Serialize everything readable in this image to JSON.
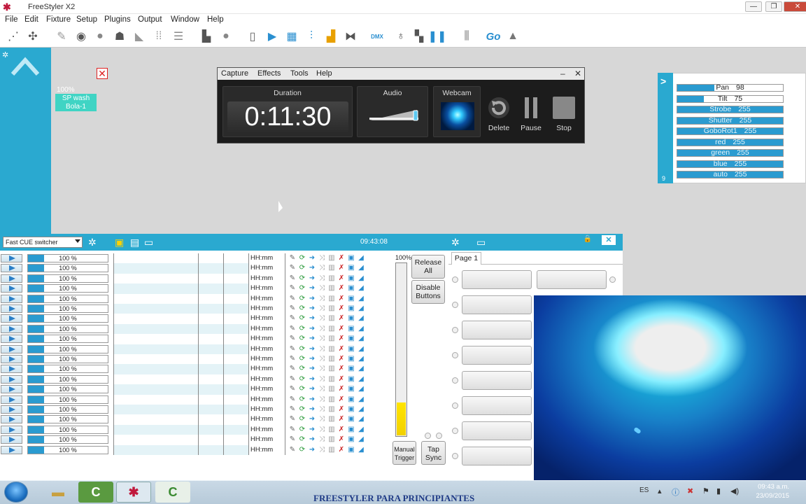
{
  "app": {
    "title": "FreeStyler X2"
  },
  "menu": [
    "File",
    "Edit",
    "Fixture",
    "Setup",
    "Plugins",
    "Output",
    "Window",
    "Help"
  ],
  "window_buttons": {
    "minimize": "—",
    "maximize": "❐",
    "close": "✕"
  },
  "toolbar": {
    "go_label": "Go",
    "dmx_label": "DMX"
  },
  "fixture": {
    "percent": "100%",
    "name_line1": "SP wash",
    "name_line2": "Bola-1"
  },
  "capture": {
    "menu": [
      "Capture",
      "Effects",
      "Tools",
      "Help"
    ],
    "duration_label": "Duration",
    "duration_value": "0:11:30",
    "audio_label": "Audio",
    "webcam_label": "Webcam",
    "delete_label": "Delete",
    "pause_label": "Pause",
    "stop_label": "Stop",
    "audio_level": 0.9
  },
  "channels": {
    "page_number": "9",
    "items": [
      {
        "name": "Pan",
        "value": "98",
        "highlight": false
      },
      {
        "name": "Tilt",
        "value": "75",
        "highlight": false
      },
      {
        "name": "Strobe",
        "value": "255",
        "highlight": true
      },
      {
        "name": "Shutter",
        "value": "255",
        "highlight": true
      },
      {
        "name": "GoboRot1",
        "value": "255",
        "highlight": true
      },
      {
        "name": "red",
        "value": "255",
        "highlight": true
      },
      {
        "name": "green",
        "value": "255",
        "highlight": true
      },
      {
        "name": "blue",
        "value": "255",
        "highlight": true
      },
      {
        "name": "auto",
        "value": "255",
        "highlight": true
      }
    ]
  },
  "cue": {
    "switcher": "Fast CUE switcher",
    "clock": "09:43:08",
    "row_percent": "100 %",
    "row_time": "HH:mm",
    "level_label": "100%",
    "level_fill": 0.19,
    "release_all": "Release All",
    "disable_buttons": "Disable Buttons",
    "manual_trigger": "Manual Trigger",
    "tap_sync": "Tap Sync",
    "page_tab": "Page 1"
  },
  "taskbar": {
    "banner": "FREESTYLER PARA PRINCIPIANTES",
    "lang": "ES",
    "time": "09:43 a.m.",
    "date": "23/09/2015"
  },
  "colors": {
    "accent": "#2aa9d0",
    "level": "#ffe400",
    "taskbar": "#c9d9e6"
  }
}
